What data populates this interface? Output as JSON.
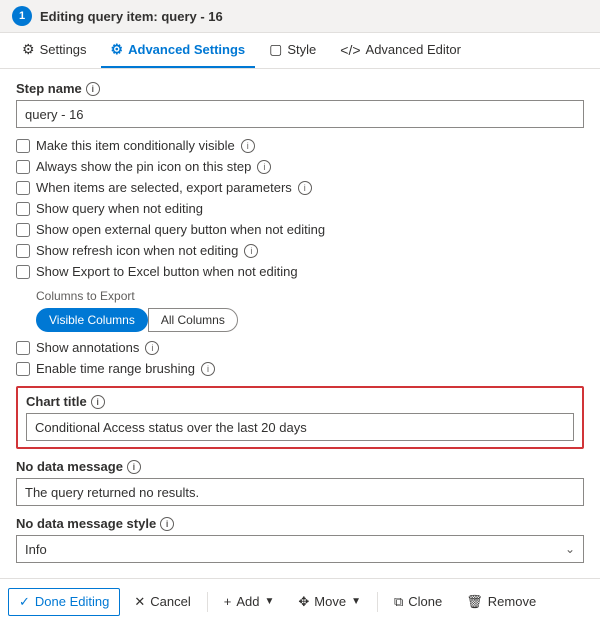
{
  "header": {
    "badge": "1",
    "title": "Editing query item: query - 16"
  },
  "tabs": [
    {
      "id": "settings",
      "label": "Settings",
      "icon": "⚙",
      "active": false
    },
    {
      "id": "advanced-settings",
      "label": "Advanced Settings",
      "icon": "⚙",
      "active": true
    },
    {
      "id": "style",
      "label": "Style",
      "icon": "☐",
      "active": false
    },
    {
      "id": "advanced-editor",
      "label": "Advanced Editor",
      "icon": "</>",
      "active": false
    }
  ],
  "form": {
    "step_name_label": "Step name",
    "step_name_value": "query - 16",
    "checkboxes": [
      {
        "id": "cond-visible",
        "label": "Make this item conditionally visible",
        "checked": false,
        "has_info": true
      },
      {
        "id": "pin-icon",
        "label": "Always show the pin icon on this step",
        "checked": false,
        "has_info": true
      },
      {
        "id": "export-params",
        "label": "When items are selected, export parameters",
        "checked": false,
        "has_info": true
      },
      {
        "id": "show-query",
        "label": "Show query when not editing",
        "checked": false,
        "has_info": false
      },
      {
        "id": "open-external",
        "label": "Show open external query button when not editing",
        "checked": false,
        "has_info": false
      },
      {
        "id": "show-refresh",
        "label": "Show refresh icon when not editing",
        "checked": false,
        "has_info": true
      },
      {
        "id": "show-export",
        "label": "Show Export to Excel button when not editing",
        "checked": false,
        "has_info": false
      }
    ],
    "columns_to_export_label": "Columns to Export",
    "columns_options": [
      {
        "label": "Visible Columns",
        "active": true
      },
      {
        "label": "All Columns",
        "active": false
      }
    ],
    "checkboxes2": [
      {
        "id": "annotations",
        "label": "Show annotations",
        "checked": false,
        "has_info": true
      },
      {
        "id": "time-range",
        "label": "Enable time range brushing",
        "checked": false,
        "has_info": true
      }
    ],
    "chart_title_label": "Chart title",
    "chart_title_info": true,
    "chart_title_value": "Conditional Access status over the last 20 days",
    "no_data_message_label": "No data message",
    "no_data_message_info": true,
    "no_data_message_value": "The query returned no results.",
    "no_data_style_label": "No data message style",
    "no_data_style_info": true,
    "no_data_style_value": "Info"
  },
  "footer": {
    "done_label": "Done Editing",
    "cancel_label": "Cancel",
    "add_label": "Add",
    "move_label": "Move",
    "clone_label": "Clone",
    "remove_label": "Remove"
  }
}
